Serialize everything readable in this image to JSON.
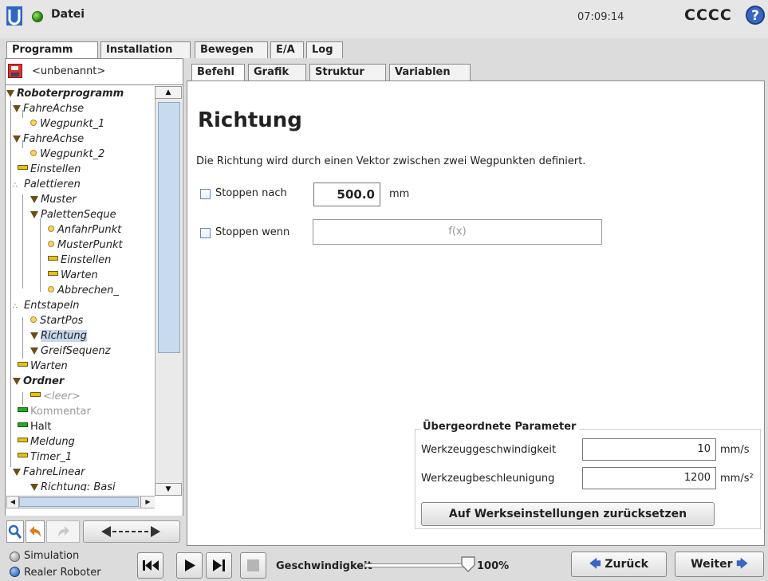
{
  "header": {
    "file_menu": "Datei",
    "clock": "07:09:14",
    "robot_name": "CCCC",
    "help_glyph": "?",
    "status_color": "#2a8a12"
  },
  "main_tabs": [
    {
      "label": "Programm",
      "active": true
    },
    {
      "label": "Installation",
      "active": false
    },
    {
      "label": "Bewegen",
      "active": false
    },
    {
      "label": "E/A",
      "active": false
    },
    {
      "label": "Log",
      "active": false
    }
  ],
  "program": {
    "name": "<unbenannt>",
    "tree": [
      {
        "label": "Roboterprogramm",
        "icon": "triangle"
      },
      {
        "label": "FahreAchse",
        "icon": "triangle"
      },
      {
        "label": "Wegpunkt_1",
        "icon": "dot"
      },
      {
        "label": "FahreAchse",
        "icon": "triangle"
      },
      {
        "label": "Wegpunkt_2",
        "icon": "dot"
      },
      {
        "label": "Einstellen",
        "icon": "bar-yellow"
      },
      {
        "label": "Palettieren",
        "icon": "pallet"
      },
      {
        "label": "Muster",
        "icon": "triangle"
      },
      {
        "label": "PalettenSeque",
        "icon": "triangle"
      },
      {
        "label": "AnfahrPunkt",
        "icon": "dot"
      },
      {
        "label": "MusterPunkt",
        "icon": "dot"
      },
      {
        "label": "Einstellen",
        "icon": "bar-yellow"
      },
      {
        "label": "Warten",
        "icon": "bar-yellow"
      },
      {
        "label": "Abbrechen_",
        "icon": "dot"
      },
      {
        "label": "Entstapeln",
        "icon": "pallet"
      },
      {
        "label": "StartPos",
        "icon": "dot"
      },
      {
        "label": "Richtung",
        "icon": "triangle",
        "selected": true
      },
      {
        "label": "GreifSequenz",
        "icon": "triangle"
      },
      {
        "label": "Warten",
        "icon": "bar-yellow"
      },
      {
        "label": "Ordner",
        "icon": "triangle"
      },
      {
        "label": "<leer>",
        "icon": "bar-yellow"
      },
      {
        "label": "Kommentar",
        "icon": "bar-green"
      },
      {
        "label": "Halt",
        "icon": "bar-green"
      },
      {
        "label": "Meldung",
        "icon": "bar-yellow"
      },
      {
        "label": "Timer_1",
        "icon": "bar-yellow"
      },
      {
        "label": "FahreLinear",
        "icon": "triangle"
      },
      {
        "label": "Richtung: Basi",
        "icon": "triangle"
      }
    ]
  },
  "sub_tabs": [
    {
      "label": "Befehl",
      "active": true
    },
    {
      "label": "Grafik",
      "active": false
    },
    {
      "label": "Struktur",
      "active": false
    },
    {
      "label": "Variablen",
      "active": false
    }
  ],
  "command": {
    "title": "Richtung",
    "description": "Die Richtung wird durch einen Vektor zwischen zwei Wegpunkten definiert.",
    "stop_after": {
      "label": "Stoppen nach",
      "value": "500.0",
      "unit": "mm",
      "checked": false
    },
    "stop_when": {
      "label": "Stoppen wenn",
      "placeholder": "f(x)",
      "checked": false
    }
  },
  "parameters": {
    "title": "Übergeordnete Parameter",
    "tool_speed": {
      "label": "Werkzeuggeschwindigkeit",
      "value": "10",
      "unit": "mm/s"
    },
    "tool_accel": {
      "label": "Werkzeugbeschleunigung",
      "value": "1200",
      "unit": "mm/s²"
    },
    "reset_label": "Auf Werkseinstellungen zurücksetzen"
  },
  "bottom": {
    "simulation_label": "Simulation",
    "real_robot_label": "Realer Roboter",
    "speed_label": "Geschwindigkeit",
    "speed_value": "100%",
    "speed_fraction": 1.0,
    "back_label": "Zurück",
    "next_label": "Weiter",
    "arrow_color": "#3a66c2"
  }
}
